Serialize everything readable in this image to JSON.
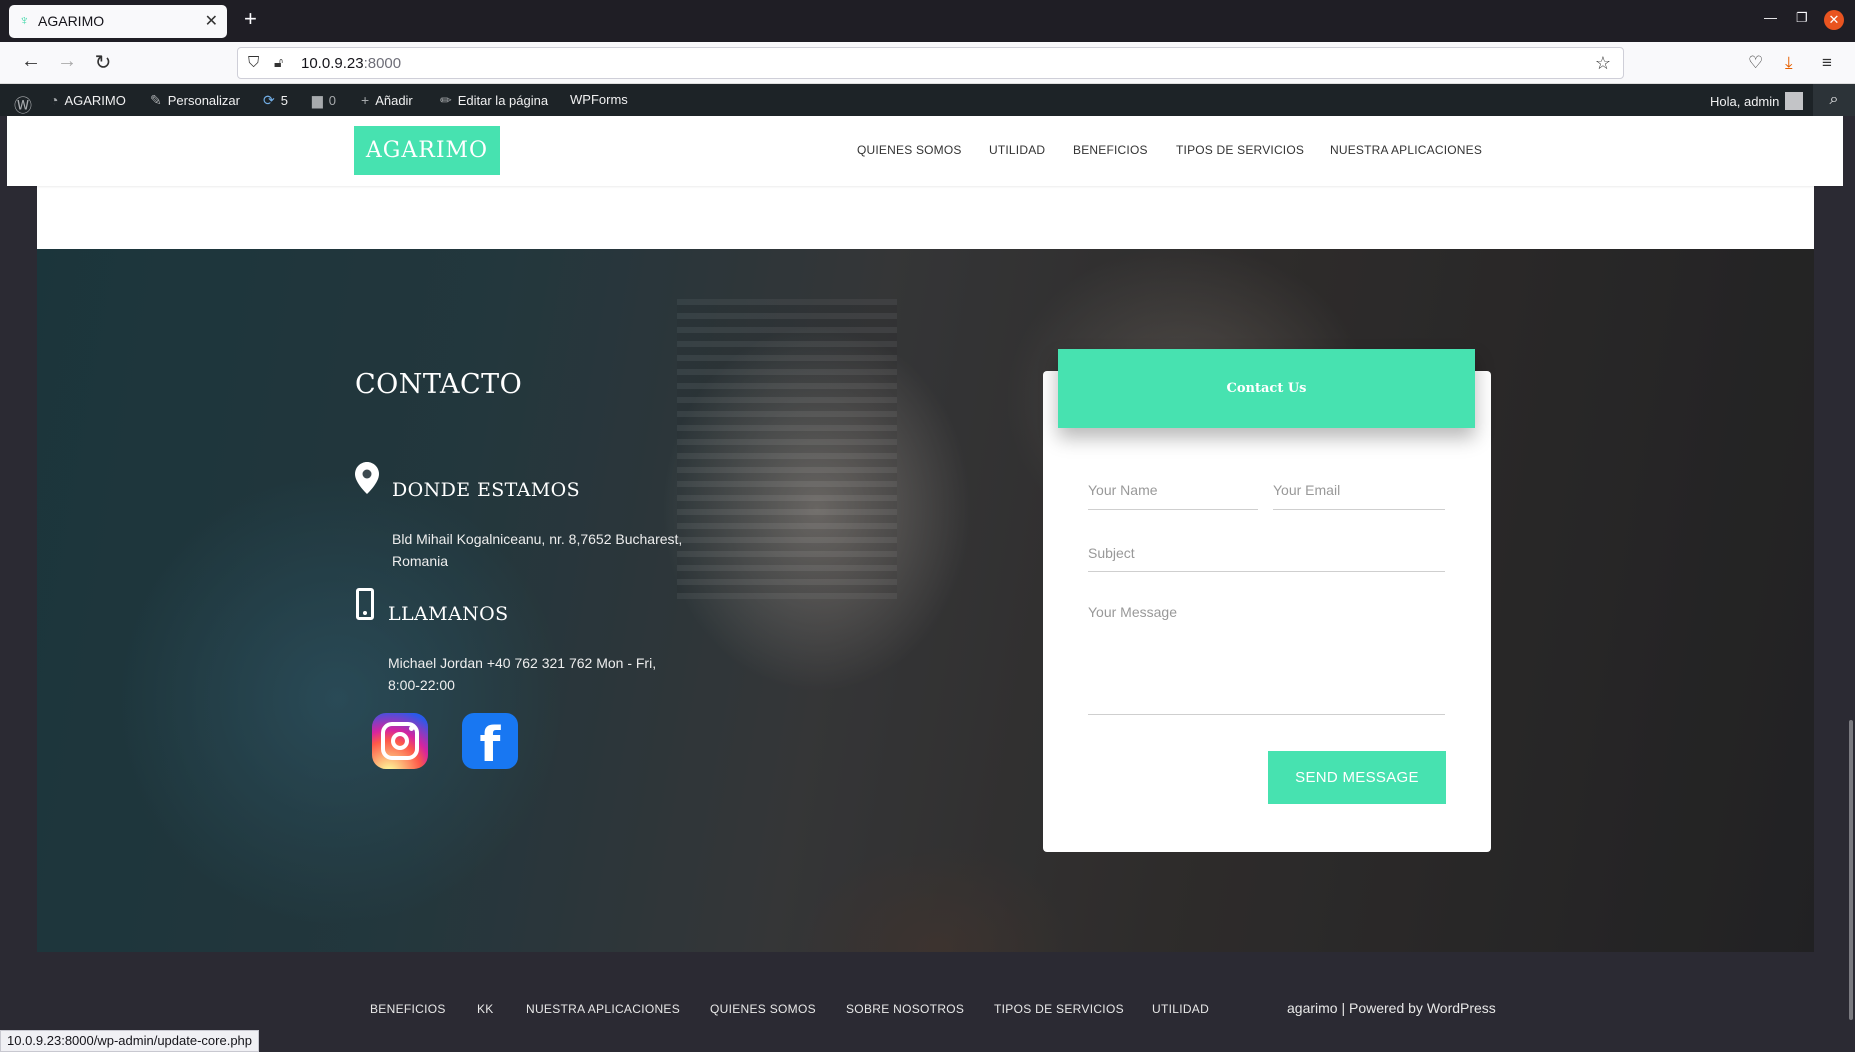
{
  "browser": {
    "tab_title": "AGARIMO",
    "url_host": "10.0.9.23",
    "url_port": ":8000",
    "status_url": "10.0.9.23:8000/wp-admin/update-core.php"
  },
  "adminbar": {
    "site_name": "AGARIMO",
    "customize": "Personalizar",
    "updates_count": "5",
    "comments_count": "0",
    "add_new": "Añadir",
    "edit_page": "Editar la página",
    "wpforms": "WPForms",
    "greeting": "Hola, admin"
  },
  "site": {
    "logo": "AGARIMO",
    "menu": [
      "QUIENES SOMOS",
      "UTILIDAD",
      "BENEFICIOS",
      "TIPOS DE SERVICIOS",
      "NUESTRA APLICACIONES"
    ]
  },
  "contact": {
    "title": "CONTACTO",
    "where_title": "DONDE ESTAMOS",
    "address_line1": "Bld Mihail Kogalniceanu, nr. 8,7652 Bucharest,",
    "address_line2": "Romania",
    "call_title": "LLAMANOS",
    "phone_line1": "Michael Jordan +40 762 321 762 Mon - Fri,",
    "phone_line2": "8:00-22:00"
  },
  "form": {
    "header": "Contact Us",
    "name_placeholder": "Your Name",
    "email_placeholder": "Your Email",
    "subject_placeholder": "Subject",
    "message_placeholder": "Your Message",
    "send_label": "SEND MESSAGE"
  },
  "footer": {
    "links": [
      "BENEFICIOS",
      "KK",
      "NUESTRA APLICACIONES",
      "QUIENES SOMOS",
      "SOBRE NOSOTROS",
      "TIPOS DE SERVICIOS",
      "UTILIDAD"
    ],
    "credit_prefix": "agarimo | Powered by ",
    "credit_link": "WordPress"
  },
  "colors": {
    "accent": "#47e2b0",
    "admin_bar": "#1d2327"
  }
}
